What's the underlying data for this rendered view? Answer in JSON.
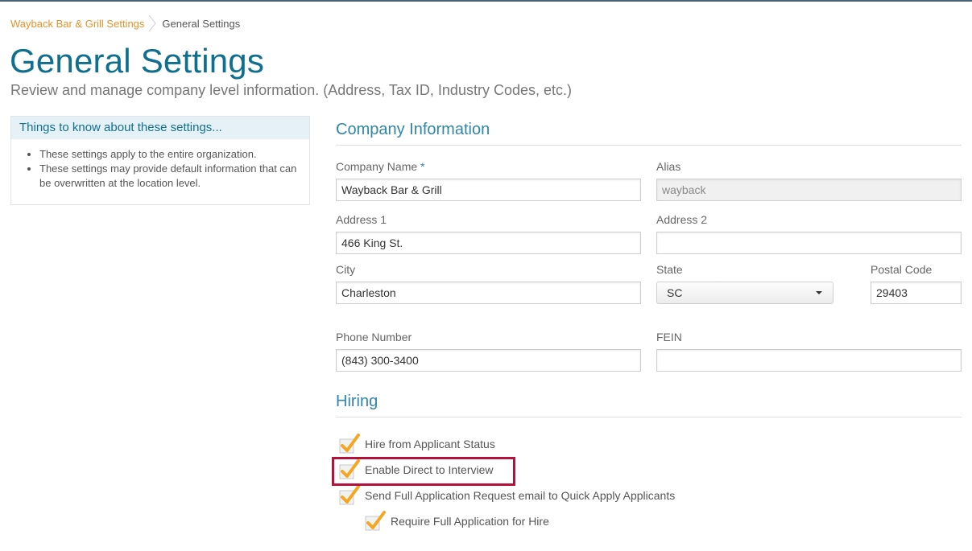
{
  "breadcrumb": {
    "parent": "Wayback Bar & Grill Settings",
    "current": "General Settings"
  },
  "page": {
    "title": "General Settings",
    "subtitle": "Review and manage company level information. (Address, Tax ID, Industry Codes, etc.)"
  },
  "info_box": {
    "heading": "Things to know about these settings...",
    "items": [
      "These settings apply to the entire organization.",
      "These settings may provide default information that can be overwritten at the location level."
    ]
  },
  "company": {
    "section_title": "Company Information",
    "company_name_label": "Company Name",
    "required_mark": "*",
    "company_name_value": "Wayback Bar & Grill",
    "alias_label": "Alias",
    "alias_value": "wayback",
    "address1_label": "Address 1",
    "address1_value": "466 King St.",
    "address2_label": "Address 2",
    "address2_value": "",
    "city_label": "City",
    "city_value": "Charleston",
    "state_label": "State",
    "state_value": "SC",
    "postal_label": "Postal Code",
    "postal_value": "29403",
    "phone_label": "Phone Number",
    "phone_value": "(843) 300-3400",
    "fein_label": "FEIN",
    "fein_value": ""
  },
  "hiring": {
    "section_title": "Hiring",
    "options": [
      {
        "label": "Hire from Applicant Status",
        "checked": true
      },
      {
        "label": "Enable Direct to Interview",
        "checked": true
      },
      {
        "label": "Send Full Application Request email to Quick Apply Applicants",
        "checked": true
      },
      {
        "label": "Require Full Application for Hire",
        "checked": true
      }
    ]
  },
  "colors": {
    "accent": "#0e6f8e",
    "link": "#e8922a",
    "check": "#f5a623",
    "highlight": "#b3123c"
  }
}
